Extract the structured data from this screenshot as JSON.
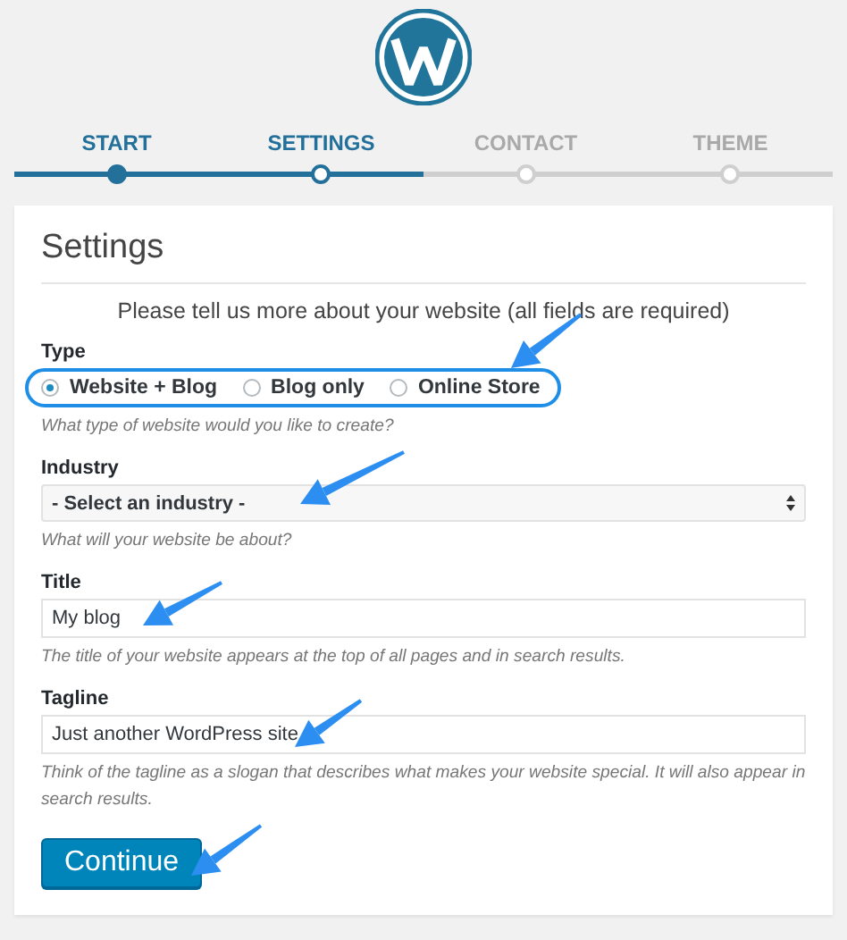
{
  "steps": [
    {
      "label": "START",
      "completed": true,
      "selected": false
    },
    {
      "label": "SETTINGS",
      "completed": false,
      "selected": true
    },
    {
      "label": "CONTACT",
      "completed": false,
      "selected": false
    },
    {
      "label": "THEME",
      "completed": false,
      "selected": false
    }
  ],
  "card": {
    "title": "Settings",
    "intro": "Please tell us more about your website (all fields are required)",
    "fields": [
      {
        "kind": "radio",
        "label": "Type",
        "highlighted": true,
        "options": [
          {
            "label": "Website + Blog",
            "selected": true
          },
          {
            "label": "Blog only",
            "selected": false
          },
          {
            "label": "Online Store",
            "selected": false
          }
        ],
        "hint": "What type of website would you like to create?"
      },
      {
        "kind": "select",
        "label": "Industry",
        "value": "- Select an industry -",
        "hint": "What will your website be about?"
      },
      {
        "kind": "text",
        "label": "Title",
        "value": "My blog",
        "hint": "The title of your website appears at the top of all pages and in search results."
      },
      {
        "kind": "text",
        "label": "Tagline",
        "value": "Just another WordPress site",
        "hint": "Think of the tagline as a slogan that describes what makes your website special. It will also appear in search results."
      }
    ],
    "button": "Continue"
  }
}
